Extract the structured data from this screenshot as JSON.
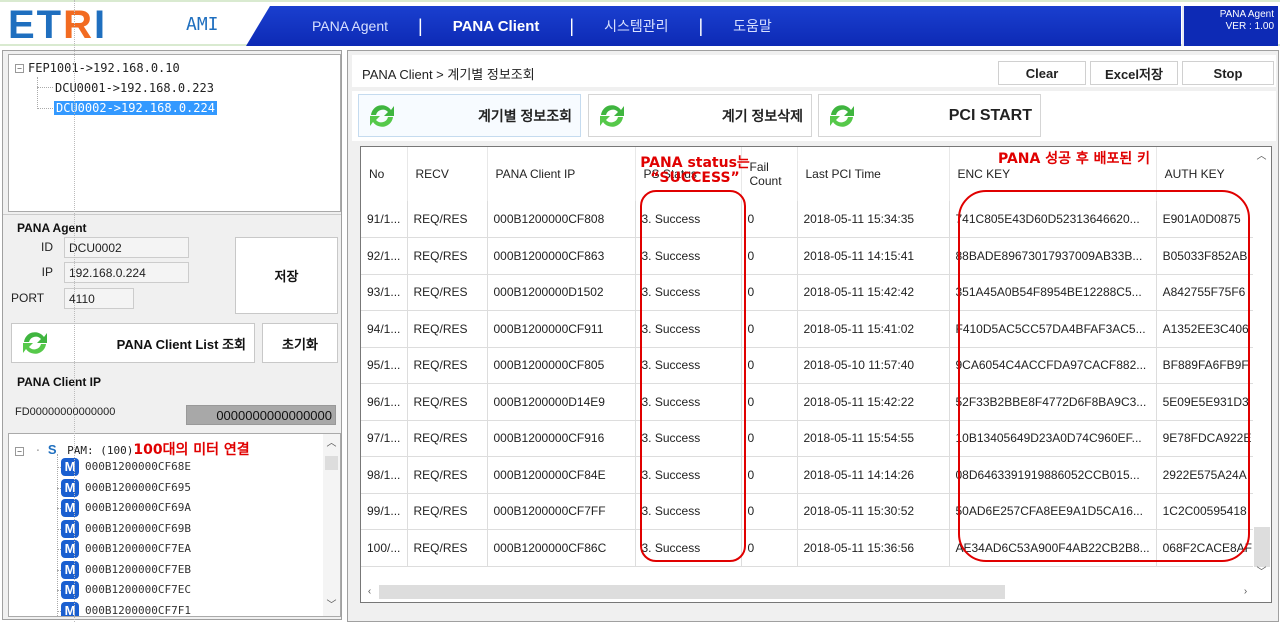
{
  "header": {
    "logo": {
      "et": "ET",
      "r": "R",
      "i": "I"
    },
    "app_name": "AMI",
    "nav": [
      {
        "label": "PANA Agent",
        "active": false
      },
      {
        "label": "PANA Client",
        "active": true
      },
      {
        "label": "시스템관리",
        "active": false
      },
      {
        "label": "도움말",
        "active": false
      }
    ],
    "separator": "|",
    "version_title": "PANA Agent",
    "version": "VER : 1.00"
  },
  "device_tree": {
    "root": "FEP1001->192.168.0.10",
    "children": [
      "DCU0001->192.168.0.223",
      "DCU0002->192.168.0.224"
    ],
    "selected_index": 1,
    "expander": "⊟"
  },
  "agent": {
    "title": "PANA Agent",
    "id_label": "ID",
    "id_value": "DCU0002",
    "ip_label": "IP",
    "ip_value": "192.168.0.224",
    "port_label": "PORT",
    "port_value": "4110",
    "save_label": "저장"
  },
  "client_list": {
    "query_label": "PANA Client List 조회",
    "reset_label": "초기화"
  },
  "client_ip": {
    "title": "PANA Client IP",
    "prefix_value": "FD00000000000000",
    "suffix_value": "0000000000000000"
  },
  "meter_tree": {
    "root_icon": "S",
    "root_label": "PAM: (100)",
    "annotation": "100대의 미터 연결",
    "meter_icon": "M",
    "meters": [
      "000B1200000CF68E",
      "000B1200000CF695",
      "000B1200000CF69A",
      "000B1200000CF69B",
      "000B1200000CF7EA",
      "000B1200000CF7EB",
      "000B1200000CF7EC",
      "000B1200000CF7F1"
    ]
  },
  "breadcrumb": "PANA Client > 계기별 정보조회",
  "toolbar": {
    "clear_label": "Clear",
    "excel_label": "Excel저장",
    "stop_label": "Stop"
  },
  "actions": {
    "query_label": "계기별 정보조회",
    "delete_label": "계기 정보삭제",
    "pci_label": "PCI START"
  },
  "grid": {
    "columns": [
      "No",
      "RECV",
      "PANA Client IP",
      "PS Status",
      "Fail\nCount",
      "Last PCI Time",
      "ENC KEY",
      "AUTH KEY"
    ],
    "rows": [
      [
        "91/1...",
        "REQ/RES",
        "000B1200000CF808",
        "3. Success",
        "0",
        "2018-05-11 15:34:35",
        "741C805E43D60D52313646620...",
        "E901A0D0875"
      ],
      [
        "92/1...",
        "REQ/RES",
        "000B1200000CF863",
        "3. Success",
        "0",
        "2018-05-11 14:15:41",
        "88BADE89673017937009AB33B...",
        "B05033F852AB"
      ],
      [
        "93/1...",
        "REQ/RES",
        "000B1200000D1502",
        "3. Success",
        "0",
        "2018-05-11 15:42:42",
        "351A45A0B54F8954BE12288C5...",
        "A842755F75F6"
      ],
      [
        "94/1...",
        "REQ/RES",
        "000B1200000CF911",
        "3. Success",
        "0",
        "2018-05-11 15:41:02",
        "F410D5AC5CC57DA4BFAF3AC5...",
        "A1352EE3C406"
      ],
      [
        "95/1...",
        "REQ/RES",
        "000B1200000CF805",
        "3. Success",
        "0",
        "2018-05-10 11:57:40",
        "9CA6054C4ACCFDA97CACF882...",
        "BF889FA6FB9F"
      ],
      [
        "96/1...",
        "REQ/RES",
        "000B1200000D14E9",
        "3. Success",
        "0",
        "2018-05-11 15:42:22",
        "52F33B2BBE8F4772D6F8BA9C3...",
        "5E09E5E931D3"
      ],
      [
        "97/1...",
        "REQ/RES",
        "000B1200000CF916",
        "3. Success",
        "0",
        "2018-05-11 15:54:55",
        "10B13405649D23A0D74C960EF...",
        "9E78FDCA922E"
      ],
      [
        "98/1...",
        "REQ/RES",
        "000B1200000CF84E",
        "3. Success",
        "0",
        "2018-05-11 14:14:26",
        "08D6463391919886052CCB015...",
        "2922E575A24A"
      ],
      [
        "99/1...",
        "REQ/RES",
        "000B1200000CF7FF",
        "3. Success",
        "0",
        "2018-05-11 15:30:52",
        "50AD6E257CFA8EE9A1D5CA16...",
        "1C2C00595418"
      ],
      [
        "100/...",
        "REQ/RES",
        "000B1200000CF86C",
        "3. Success",
        "0",
        "2018-05-11 15:36:56",
        "AE34AD6C53A900F4AB22CB2B8...",
        "068F2CACE8AF"
      ]
    ]
  },
  "annotations": {
    "status_note_line1": "PANA status는",
    "status_note_line2": "“SUCCESS”",
    "key_note": "PANA 성공 후 배포된 키"
  },
  "colors": {
    "nav_blue": "#0d2ab5",
    "logo_blue": "#1f6fbf",
    "logo_orange": "#f26b21",
    "annotation_red": "#e00000",
    "selection_blue": "#3399ff"
  }
}
